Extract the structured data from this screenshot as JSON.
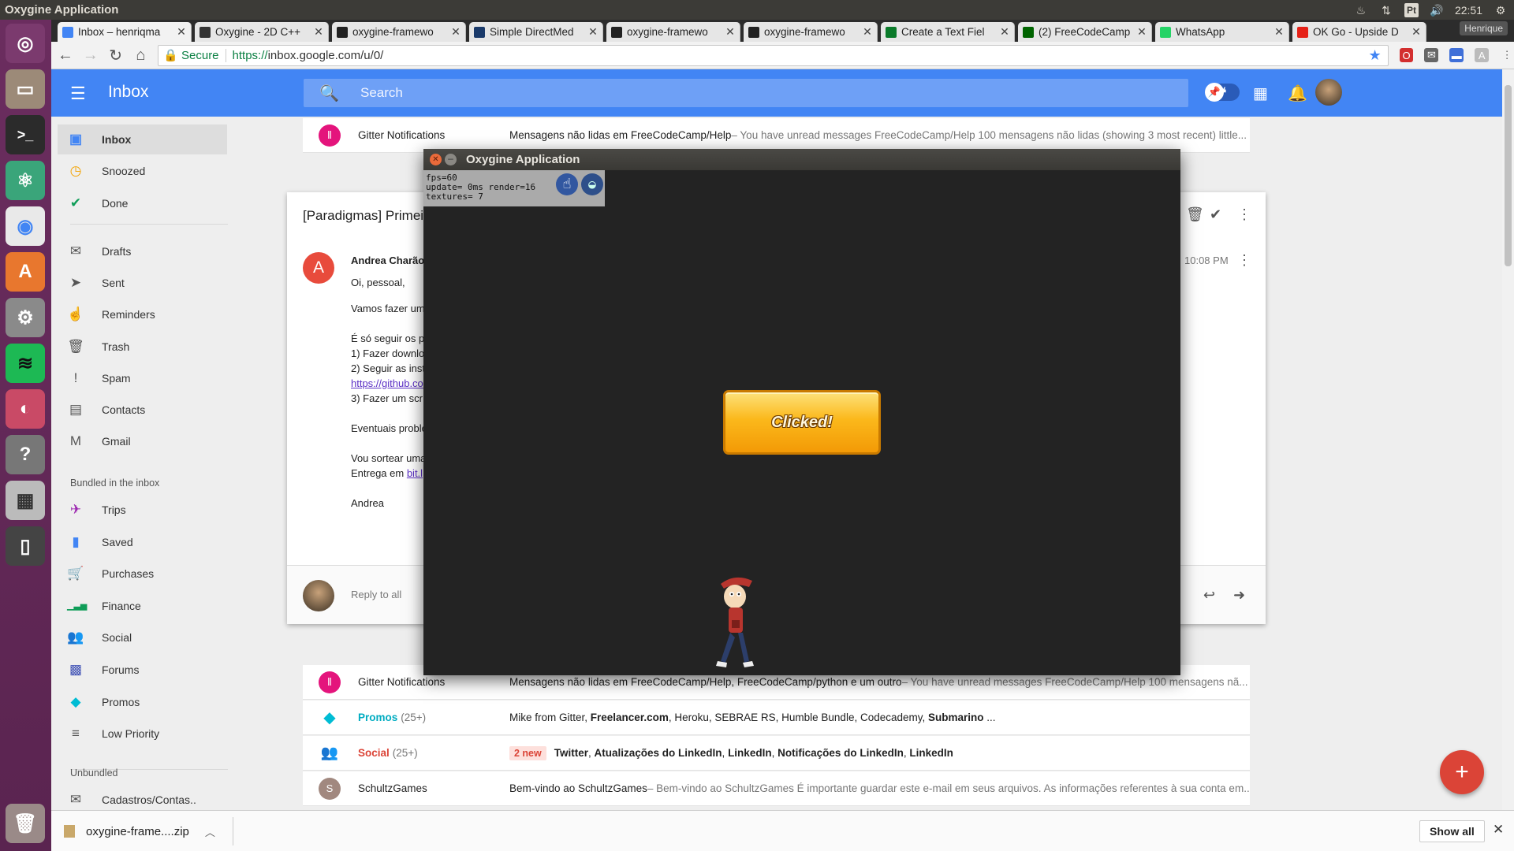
{
  "system": {
    "active_app": "Oxygine Application",
    "clock": "22:51",
    "keyboard_layout": "Pt",
    "launcher_icons": [
      "ubuntu-dash-icon",
      "files-icon",
      "terminal-icon",
      "atom-icon",
      "chrome-icon",
      "software-center-icon",
      "settings-icon",
      "spotify-icon",
      "disk-icon",
      "help-icon",
      "calculator-icon",
      "phone-icon",
      "trash-icon"
    ]
  },
  "browser": {
    "profile": "Henrique",
    "tabs": [
      {
        "label": "Inbox – henriqma",
        "color": "#4285f4",
        "active": true
      },
      {
        "label": "Oxygine - 2D C++",
        "color": "#333333"
      },
      {
        "label": "oxygine-framewo",
        "color": "#222222"
      },
      {
        "label": "Simple DirectMed",
        "color": "#1a3a6a"
      },
      {
        "label": "oxygine-framewo",
        "color": "#222222"
      },
      {
        "label": "oxygine-framewo",
        "color": "#222222"
      },
      {
        "label": "Create a Text Fiel",
        "color": "#0a7a2a"
      },
      {
        "label": "(2) FreeCodeCamp",
        "color": "#006400"
      },
      {
        "label": "WhatsApp",
        "color": "#25d366"
      },
      {
        "label": "OK Go - Upside D",
        "color": "#e62117"
      }
    ],
    "secure_label": "Secure",
    "url_scheme": "https://",
    "url_host": "inbox.google.com",
    "url_path": "/u/0/"
  },
  "inbox": {
    "title": "Inbox",
    "search_placeholder": "Search",
    "accent": "#4285f4",
    "nav": [
      {
        "label": "Inbox",
        "icon": "inbox-icon",
        "active": true
      },
      {
        "label": "Snoozed",
        "icon": "clock-icon"
      },
      {
        "label": "Done",
        "icon": "check-icon"
      },
      {
        "label": "Drafts",
        "icon": "drafts-icon"
      },
      {
        "label": "Sent",
        "icon": "send-icon"
      },
      {
        "label": "Reminders",
        "icon": "reminder-icon"
      },
      {
        "label": "Trash",
        "icon": "trash-icon"
      },
      {
        "label": "Spam",
        "icon": "spam-icon"
      },
      {
        "label": "Contacts",
        "icon": "contacts-icon"
      },
      {
        "label": "Gmail",
        "icon": "gmail-icon"
      }
    ],
    "bundled_heading": "Bundled in the inbox",
    "bundles": [
      {
        "label": "Trips",
        "icon": "plane-icon",
        "color": "#9c27b0"
      },
      {
        "label": "Saved",
        "icon": "bookmark-icon",
        "color": "#4285f4"
      },
      {
        "label": "Purchases",
        "icon": "cart-icon",
        "color": "#555555"
      },
      {
        "label": "Finance",
        "icon": "chart-icon",
        "color": "#0f9d58"
      },
      {
        "label": "Social",
        "icon": "people-icon",
        "color": "#db4437"
      },
      {
        "label": "Forums",
        "icon": "forum-icon",
        "color": "#3f51b5"
      },
      {
        "label": "Promos",
        "icon": "tag-icon",
        "color": "#00bcd4"
      },
      {
        "label": "Low Priority",
        "icon": "low-priority-icon",
        "color": "#555555"
      }
    ],
    "unbundled_heading": "Unbundled",
    "unbundled": [
      {
        "label": "Cadastros/Contas..",
        "icon": "mail-icon"
      }
    ],
    "top_row": {
      "sender": "Gitter Notifications",
      "subject": "Mensagens não lidas em FreeCodeCamp/Help",
      "snippet": " – You have unread messages FreeCodeCamp/Help 100 mensagens não lidas (showing 3 most recent) little..."
    },
    "thread": {
      "subject": "[Paradigmas] Primeiro",
      "sender": "Andrea Charão",
      "avatar_letter": "A",
      "time": "10:08 PM",
      "body": [
        {
          "text": "Oi, pessoal,"
        },
        {
          "text": "Vamos fazer um"
        },
        {
          "text": "É só seguir os p"
        },
        {
          "text": "1) Fazer downlo"
        },
        {
          "text": "2) Seguir as inst"
        },
        {
          "text": "https://github.co",
          "link": true
        },
        {
          "text": "3) Fazer um scr"
        },
        {
          "text": "Eventuais proble"
        },
        {
          "text": "Vou sortear uma"
        },
        {
          "text": "Entrega em ",
          "suffix": "bit.l"
        },
        {
          "text": "Andrea"
        }
      ],
      "reply_label": "Reply to all"
    },
    "rows": [
      {
        "kind": "gitter",
        "sender": "Gitter Notifications",
        "subject": "Mensagens não lidas em FreeCodeCamp/Help, FreeCodeCamp/python e um outro",
        "snippet": " – You have unread messages FreeCodeCamp/Help 100 mensagens nã..."
      },
      {
        "kind": "promos",
        "sender": "Promos",
        "count": "(25+)",
        "subject": "Mike from Gitter, ",
        "subject_parts": [
          "Mike from Gitter, ",
          "Freelancer.com",
          ", Heroku, SEBRAE RS, Humble Bundle, Codecademy, ",
          "Submarino",
          " ..."
        ]
      },
      {
        "kind": "social",
        "sender": "Social",
        "count": "(25+)",
        "badge": "2 new",
        "subject_parts": [
          "Twitter",
          ", ",
          "Atualizações do LinkedIn",
          ", ",
          "LinkedIn",
          ", ",
          "Notificações do LinkedIn",
          ", ",
          "LinkedIn"
        ]
      },
      {
        "kind": "letter",
        "letter": "S",
        "sender": "SchultzGames",
        "subject": "Bem-vindo ao SchultzGames",
        "snippet": " – Bem-vindo ao SchultzGames É importante guardar este e-mail em seus arquivos. As informações referentes à sua conta em.."
      }
    ]
  },
  "oxygine": {
    "title": "Oxygine Application",
    "debug": [
      "fps=60",
      "update= 0ms render=16",
      "textures= 7"
    ],
    "button_label": "Clicked!"
  },
  "downloads": {
    "file": "oxygine-frame....zip",
    "show_all": "Show all"
  }
}
